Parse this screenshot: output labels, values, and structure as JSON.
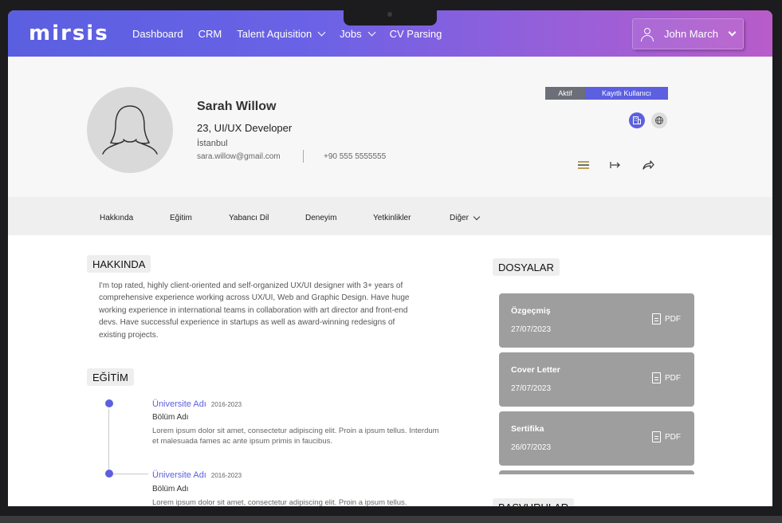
{
  "header": {
    "logo": "mirsis",
    "nav": [
      {
        "label": "Dashboard",
        "dropdown": false
      },
      {
        "label": "CRM",
        "dropdown": false
      },
      {
        "label": "Talent Aquisition",
        "dropdown": true
      },
      {
        "label": "Jobs",
        "dropdown": true
      },
      {
        "label": "CV Parsing",
        "dropdown": false
      }
    ],
    "user": "John March"
  },
  "profile": {
    "name": "Sarah Willow",
    "subtitle": "23, UI/UX Developer",
    "city": "İstanbul",
    "email": "sara.willow@gmail.com",
    "phone": "+90 555 5555555",
    "status_badge": "Aktif",
    "type_badge": "Kayıtlı Kullanıcı"
  },
  "tabs": [
    "Hakkında",
    "Eğitim",
    "Yabancı Dil",
    "Deneyim",
    "Yetkinlikler",
    "Diğer"
  ],
  "about": {
    "heading": "HAKKINDA",
    "text": "I'm top rated, highly client-oriented and self-organized UX/UI designer with 3+ years of comprehensive experience working across UX/UI, Web and Graphic Design. Have huge working experience in international teams in collaboration with art director and front-end devs. Have successful experience in startups as well as award-winning redesigns of existing projects."
  },
  "education": {
    "heading": "EĞİTİM",
    "items": [
      {
        "school": "Üniversite Adı",
        "years": "2016-2023",
        "dept": "Bölüm Adı",
        "desc": "Lorem ipsum dolor sit amet, consectetur adipiscing elit. Proin a ipsum tellus. Interdum et malesuada fames ac ante ipsum primis in faucibus."
      },
      {
        "school": "Üniversite Adı",
        "years": "2016-2023",
        "dept": "Bölüm Adı",
        "desc": "Lorem ipsum dolor sit amet, consectetur adipiscing elit. Proin a ipsum tellus."
      }
    ]
  },
  "files": {
    "heading": "DOSYALAR",
    "items": [
      {
        "name": "Özgeçmiş",
        "date": "27/07/2023",
        "type": "PDF"
      },
      {
        "name": "Cover Letter",
        "date": "27/07/2023",
        "type": "PDF"
      },
      {
        "name": "Sertifika",
        "date": "26/07/2023",
        "type": "PDF"
      }
    ]
  },
  "applications": {
    "heading": "BAŞVURULAR"
  },
  "colors": {
    "accent": "#5b5fe0",
    "header_start": "#5a5fe0",
    "header_end": "#b85cc9",
    "card": "#9e9e9e"
  }
}
